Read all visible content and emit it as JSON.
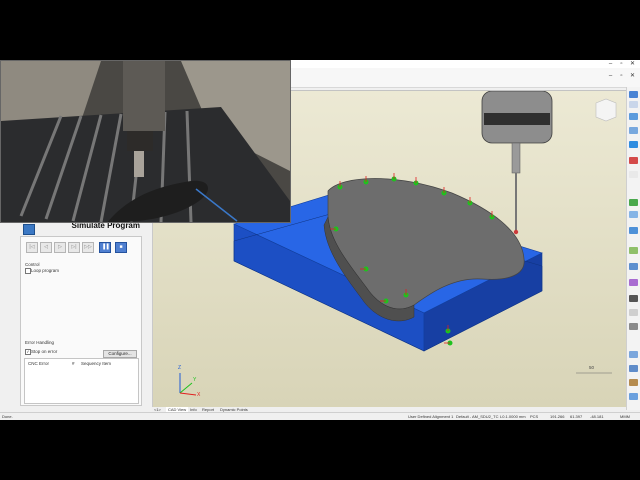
{
  "window": {
    "minimize": "–",
    "restore": "▫",
    "close": "✕"
  },
  "ribbon_tabs": [
    "",
    "",
    "",
    "",
    ""
  ],
  "panel": {
    "title": "Simulate Program",
    "toolbar": [
      "|◁",
      "◁",
      "▷",
      "▷|",
      "▷▷",
      "▐▐",
      "■"
    ],
    "control_label": "Control",
    "loop_program": "Loop program",
    "error_handling_label": "Error Handling",
    "stop_on_error": "Stop on error",
    "configure_label": "Configure...",
    "columns": [
      "CNC Error",
      "#",
      "Sequency Item"
    ]
  },
  "viewport": {
    "scale_value": "50",
    "axis_z": "Z",
    "axis_y": "Y",
    "axis_x": "X"
  },
  "bottom_tabs": [
    "<1>",
    "CAD View",
    "Info",
    "Report",
    "Dynamic Points"
  ],
  "status": {
    "left": "Done.",
    "alignment": "User Defined Alignment 1",
    "probe": "Default - AM_SDU2_TC",
    "tip": "L0.1.0000 mm",
    "cs": "PCS",
    "x": "191.266",
    "y": "61.397",
    "z": "-48.181",
    "mode": "MMM"
  },
  "colors": {
    "part_blue": "#1f5bd6",
    "part_grey": "#6b6b6b",
    "probe_point": "#1ec21e",
    "vector_red": "#e02020",
    "viewport_bg": "#e3e0c8"
  }
}
